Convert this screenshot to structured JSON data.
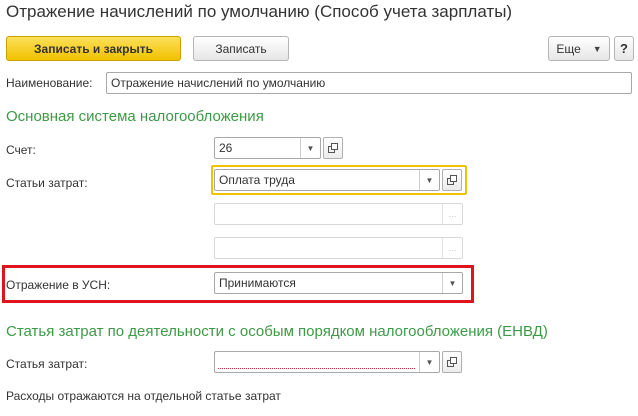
{
  "window": {
    "title": "Отражение начислений по умолчанию (Способ учета зарплаты)"
  },
  "toolbar": {
    "save_close_label": "Записать и закрыть",
    "save_label": "Записать",
    "more_label": "Еще",
    "help_label": "?"
  },
  "form": {
    "name_label": "Наименование:",
    "name_value": "Отражение начислений по умолчанию",
    "section_main": "Основная система налогообложения",
    "account_label": "Счет:",
    "account_value": "26",
    "cost_items_label": "Статьи затрат:",
    "cost_items_value": "Оплата труда",
    "usn_label": "Отражение в УСН:",
    "usn_value": "Принимаются",
    "section_envd": "Статья затрат по деятельности с особым порядком налогообложения (ЕНВД)",
    "envd_cost_label": "Статья затрат:",
    "envd_cost_value": "",
    "envd_note": "Расходы отражаются на отдельной статье затрат"
  },
  "colors": {
    "accent_yellow": "#f2c200",
    "section_green": "#3d9a47",
    "highlight_red": "#e0141e"
  }
}
